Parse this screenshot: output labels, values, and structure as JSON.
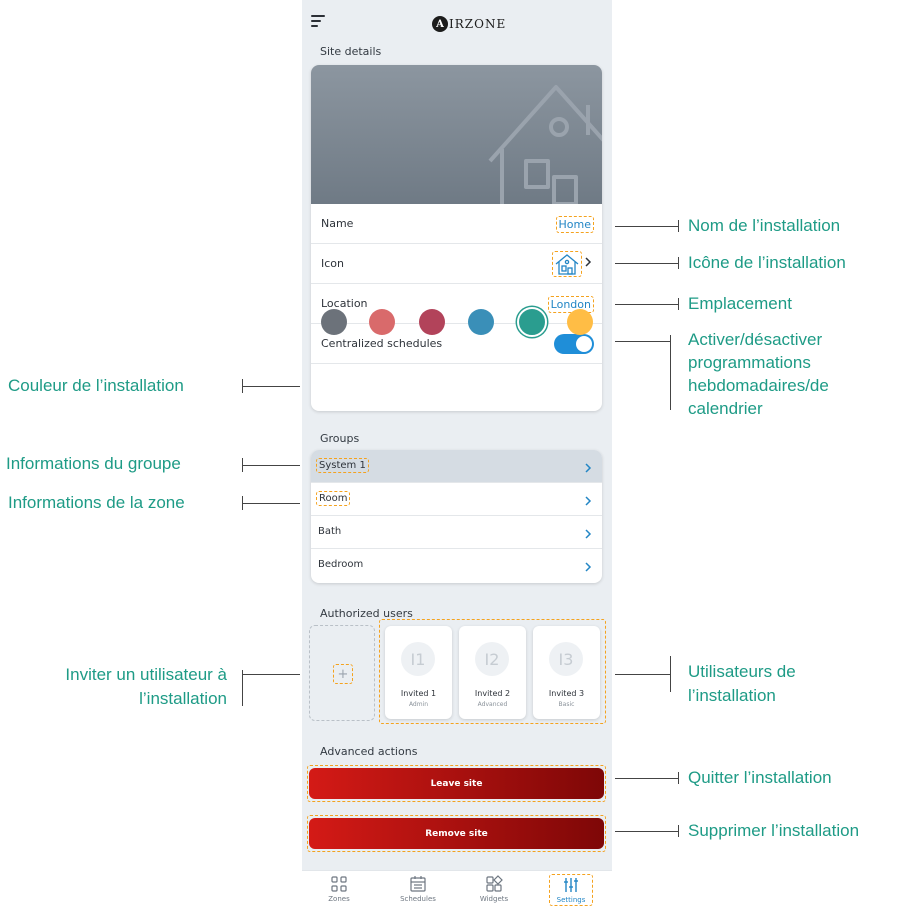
{
  "app": {
    "brand": "AIRZONE",
    "brand_mark": "A",
    "brand_rest": "IRZONE"
  },
  "site_details": {
    "section_title": "Site details",
    "rows": {
      "name": {
        "label": "Name",
        "value": "Home"
      },
      "icon": {
        "label": "Icon"
      },
      "location": {
        "label": "Location",
        "value": "London"
      },
      "schedules": {
        "label": "Centralized schedules",
        "enabled": true
      }
    },
    "colors": [
      "#6c727a",
      "#d96a6b",
      "#b2435a",
      "#3a8fb8",
      "#2a9d8f",
      "#ffbd45"
    ],
    "selected_color_index": 4
  },
  "groups": {
    "section_title": "Groups",
    "items": [
      "System 1",
      "Room",
      "Bath",
      "Bedroom"
    ]
  },
  "users": {
    "section_title": "Authorized users",
    "items": [
      {
        "initials": "I1",
        "name": "Invited 1",
        "role": "Admin"
      },
      {
        "initials": "I2",
        "name": "Invited 2",
        "role": "Advanced"
      },
      {
        "initials": "I3",
        "name": "Invited 3",
        "role": "Basic"
      }
    ],
    "add_symbol": "+"
  },
  "advanced": {
    "section_title": "Advanced actions",
    "leave_label": "Leave site",
    "remove_label": "Remove site"
  },
  "nav": {
    "zones": "Zones",
    "schedules": "Schedules",
    "widgets": "Widgets",
    "settings": "Settings",
    "active": "settings"
  },
  "annotations": {
    "name": "Nom de l’installation",
    "icon": "Icône de l’installation",
    "location": "Emplacement",
    "schedules_1": "Activer/désactiver",
    "schedules_2": "programmations",
    "schedules_3": "hebdomadaires/de",
    "schedules_4": "calendrier",
    "color": "Couleur de l’installation",
    "group": "Informations du groupe",
    "zone": "Informations de la zone",
    "invite_1": "Inviter un utilisateur à",
    "invite_2": "l’installation",
    "users_1": "Utilisateurs de",
    "users_2": "l’installation",
    "leave": "Quitter l’installation",
    "remove": "Supprimer l’installation"
  }
}
